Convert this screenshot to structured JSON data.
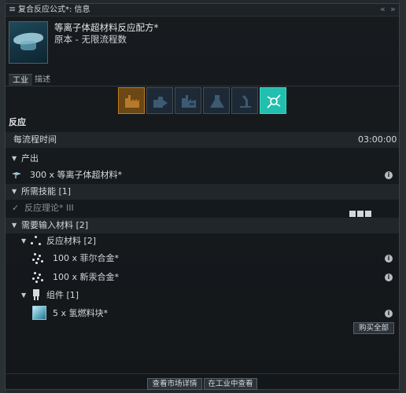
{
  "window": {
    "title": "复合反应公式*: 信息",
    "collapse_icon": "«",
    "expand_icon": "»"
  },
  "header": {
    "title": "等离子体超材料反应配方*",
    "subtitle": "原本 - 无限流程数"
  },
  "tabs": [
    {
      "label": "工业"
    },
    {
      "label": "描述"
    }
  ],
  "activity_icons": [
    {
      "name": "manufacturing-icon",
      "state": "inactive-highlight"
    },
    {
      "name": "copy-icon",
      "state": "inactive"
    },
    {
      "name": "invention-icon",
      "state": "inactive"
    },
    {
      "name": "research-icon",
      "state": "inactive"
    },
    {
      "name": "science-icon",
      "state": "inactive"
    },
    {
      "name": "reaction-icon",
      "state": "active"
    }
  ],
  "section_heading": "反应",
  "time": {
    "label": "每流程时间",
    "value": "03:00:00"
  },
  "outputs": {
    "header": "产出",
    "items": [
      {
        "text": "300 x 等离子体超材料*"
      }
    ]
  },
  "skills": {
    "header": "所需技能 [1]",
    "items": [
      {
        "text": "反应理论* III"
      }
    ]
  },
  "inputs": {
    "header": "需要输入材料 [2]",
    "reaction_materials": {
      "header": "反应材料 [2]",
      "items": [
        {
          "text": "100 x 菲尔合金*"
        },
        {
          "text": "100 x 新汞合金*"
        }
      ]
    },
    "components": {
      "header": "组件 [1]",
      "items": [
        {
          "text": "5 x 氢燃料块*"
        }
      ]
    },
    "buy_all_label": "购买全部"
  },
  "footer": {
    "market_button": "查看市场详情",
    "industry_button": "在工业中查看"
  },
  "colors": {
    "accent_teal": "#23bfae",
    "accent_orange": "#6b4715",
    "window_bg": "#15191c"
  }
}
